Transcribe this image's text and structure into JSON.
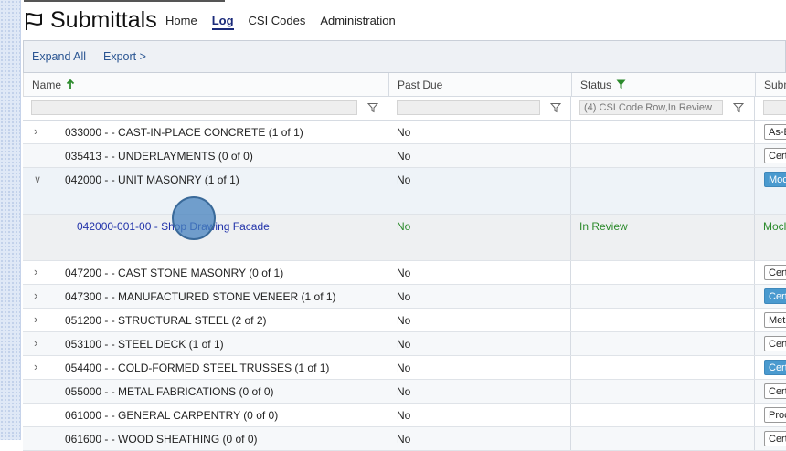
{
  "header": {
    "title": "Submittals",
    "nav": [
      {
        "label": "Home",
        "active": false
      },
      {
        "label": "Log",
        "active": true
      },
      {
        "label": "CSI Codes",
        "active": false
      },
      {
        "label": "Administration",
        "active": false
      }
    ]
  },
  "toolbar": {
    "expand_all": "Expand All",
    "export": "Export >"
  },
  "columns": {
    "name": "Name",
    "past_due": "Past Due",
    "status": "Status",
    "type": "Subm"
  },
  "filters": {
    "name": "",
    "past_due": "",
    "status": "(4) CSI Code Row,In Review",
    "type": ""
  },
  "rows": [
    {
      "name": "033000 - - CAST-IN-PLACE CONCRETE (1 of 1)",
      "past_due": "No",
      "type": "As-B",
      "chevron": true,
      "badge_blue": false
    },
    {
      "name": "035413 - - UNDERLAYMENTS (0 of 0)",
      "past_due": "No",
      "type": "Cert",
      "chevron": false,
      "badge_blue": false
    },
    {
      "name": "042000 - - UNIT MASONRY (1 of 1)",
      "past_due": "No",
      "type": "Moc",
      "chevron": true,
      "expanded": true,
      "badge_blue": true
    },
    {
      "name": "042000-001-00 - Shop Drawing Facade",
      "past_due": "No",
      "status": "In Review",
      "type": "Mocl",
      "child": true
    },
    {
      "name": "047200 - - CAST STONE MASONRY (0 of 1)",
      "past_due": "No",
      "type": "Cert",
      "chevron": true,
      "badge_blue": false
    },
    {
      "name": "047300 - - MANUFACTURED STONE VENEER (1 of 1)",
      "past_due": "No",
      "type": "Cert",
      "chevron": true,
      "badge_blue": true
    },
    {
      "name": "051200 - - STRUCTURAL STEEL (2 of 2)",
      "past_due": "No",
      "type": "Met",
      "chevron": true,
      "badge_blue": false
    },
    {
      "name": "053100 - - STEEL DECK (1 of 1)",
      "past_due": "No",
      "type": "Cert",
      "chevron": true,
      "badge_blue": false
    },
    {
      "name": "054400 - - COLD-FORMED STEEL TRUSSES (1 of 1)",
      "past_due": "No",
      "type": "Cert",
      "chevron": true,
      "badge_blue": true
    },
    {
      "name": "055000 - - METAL FABRICATIONS (0 of 0)",
      "past_due": "No",
      "type": "Cert",
      "chevron": false,
      "badge_blue": false
    },
    {
      "name": "061000 - - GENERAL CARPENTRY (0 of 0)",
      "past_due": "No",
      "type": "Proc",
      "chevron": false,
      "badge_blue": false
    },
    {
      "name": "061600 - - WOOD SHEATHING (0 of 0)",
      "past_due": "No",
      "type": "Cert",
      "chevron": false,
      "badge_blue": false
    }
  ],
  "colors": {
    "link": "#2233aa",
    "accent": "#1a2a7a",
    "badge_blue": "#4a9acf",
    "child_green": "#2b8a2b",
    "filter_green": "#2b8a2b"
  }
}
